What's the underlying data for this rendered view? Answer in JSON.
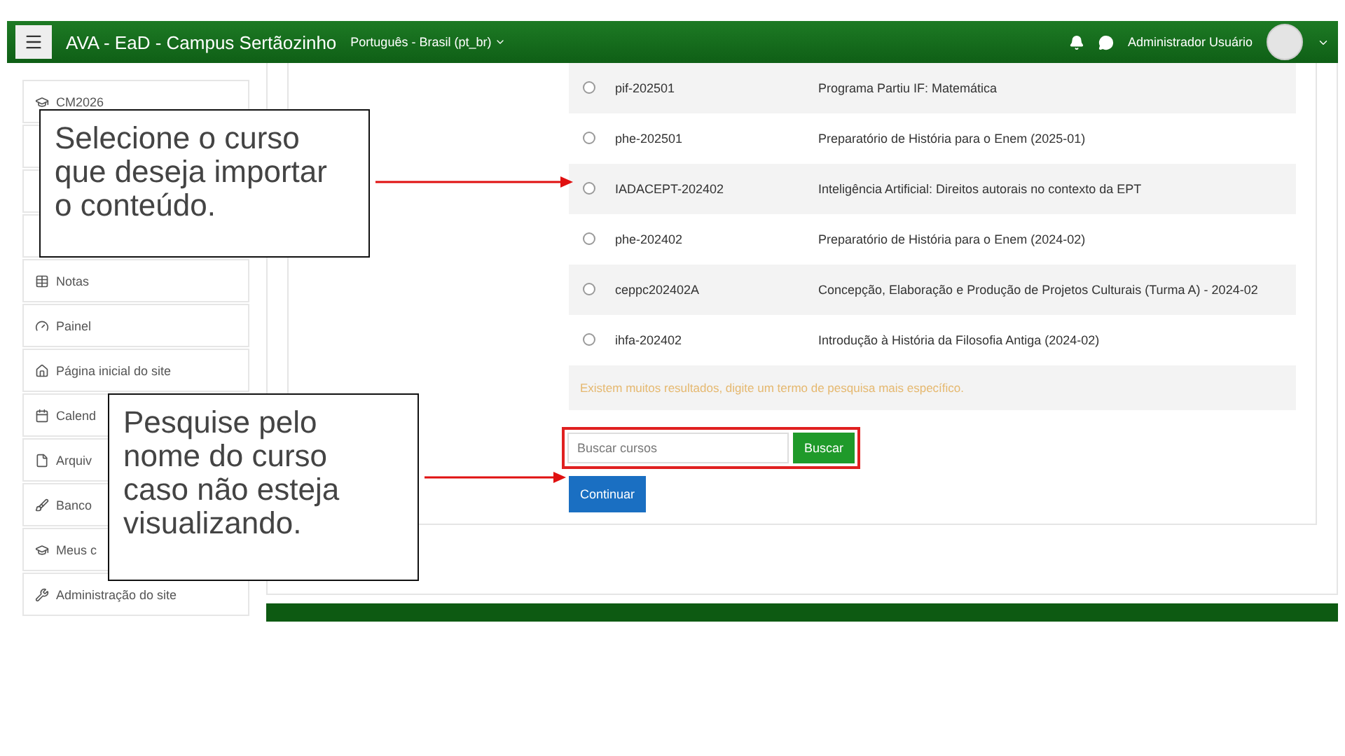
{
  "navbar": {
    "site_name": "AVA - EaD - Campus Sertãozinho",
    "language": "Português - Brasil (pt_br)",
    "user_name": "Administrador Usuário"
  },
  "sidebar": {
    "items": [
      {
        "label": "CM2026"
      },
      {
        "label": "Notas"
      },
      {
        "label": "Painel"
      },
      {
        "label": "Página inicial do site"
      },
      {
        "label": "Calend"
      },
      {
        "label": "Arquiv"
      },
      {
        "label": "Banco"
      },
      {
        "label": "Meus c"
      },
      {
        "label": "Administração do site"
      }
    ]
  },
  "courses": [
    {
      "short_name": "pif-202501",
      "full_name": "Programa Partiu IF: Matemática",
      "selected": false
    },
    {
      "short_name": "phe-202501",
      "full_name": "Preparatório de História para o Enem (2025-01)",
      "selected": false
    },
    {
      "short_name": "IADACEPT-202402",
      "full_name": "Inteligência Artificial: Direitos autorais no contexto da EPT",
      "selected": false
    },
    {
      "short_name": "phe-202402",
      "full_name": "Preparatório de História para o Enem (2024-02)",
      "selected": false
    },
    {
      "short_name": "ceppc202402A",
      "full_name": "Concepção, Elaboração e Produção de Projetos Culturais (Turma A) - 2024-02",
      "selected": false
    },
    {
      "short_name": "ihfa-202402",
      "full_name": "Introdução à História da Filosofia Antiga (2024-02)",
      "selected": false
    }
  ],
  "warning": "Existem muitos resultados, digite um termo de pesquisa mais específico.",
  "search": {
    "placeholder": "Buscar cursos",
    "button": "Buscar"
  },
  "continue_button": "Continuar",
  "callouts": [
    {
      "text": "Selecione o curso que deseja importar o conteúdo."
    },
    {
      "text": "Pesquise pelo nome do curso caso não esteja visualizando."
    }
  ]
}
